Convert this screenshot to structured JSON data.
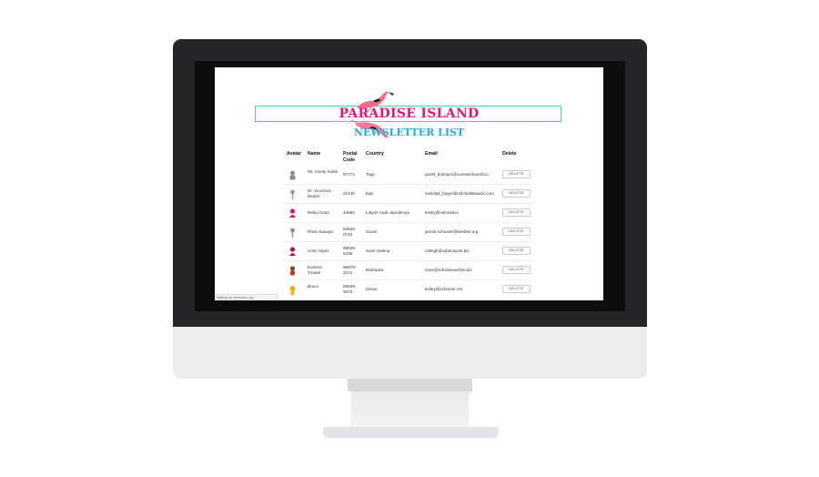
{
  "header": {
    "title": "PARADISE ISLAND",
    "subtitle": "NEWSLETTER LIST"
  },
  "table": {
    "columns": [
      "Avatar",
      "Name",
      "Postal Code",
      "Country",
      "Email",
      "Delete"
    ],
    "rows": [
      {
        "name": "Mr. Amely Kulas",
        "postal": "97774",
        "country": "Togo",
        "email": "jarrell_bosham@conewinhamill.co",
        "avatar_color": "#8a8a8a",
        "delete": "DELETE"
      },
      {
        "name": "Dr. Vincenza Barton",
        "postal": "31440",
        "country": "Italy",
        "email": "nickolas_bayer@mitchellabaack.com",
        "avatar_color": "#9a9a9a",
        "delete": "DELETE"
      },
      {
        "name": "Reba Grant",
        "postal": "44690",
        "country": "Libyan Arab Jamahiriya",
        "email": "lesley@mitchell.io",
        "avatar_color": "#d0166f",
        "delete": "DELETE"
      },
      {
        "name": "Rhea Sawayn",
        "postal": "64630-0744",
        "country": "Guam",
        "email": "jannie.schuster@keebler.org",
        "avatar_color": "#8f8f8f",
        "delete": "DELETE"
      },
      {
        "name": "Arnie Sipes",
        "postal": "98025-5436",
        "country": "Saint Helena",
        "email": "caleigh@adamsyost.biz",
        "avatar_color": "#b0154f",
        "delete": "DELETE"
      },
      {
        "name": "Kamron Treutel",
        "postal": "96878-2274",
        "country": "Barbados",
        "email": "zane@rohanleuschke.biz",
        "avatar_color": "#7a4a2a",
        "delete": "DELETE"
      },
      {
        "name": "Bruce",
        "postal": "95939-3673",
        "country": "Oman",
        "email": "kelley@schinner.net",
        "avatar_color": "#e8b21a",
        "delete": "DELETE"
      }
    ]
  },
  "status_bar": {
    "text": "Waiting for rebelmarc.org..."
  },
  "colors": {
    "brand_pink": "#e0187a",
    "brand_blue": "#2aa7d6",
    "monitor_bezel": "#262628"
  }
}
